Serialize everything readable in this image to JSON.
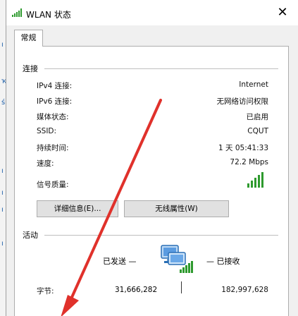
{
  "window": {
    "title": "WLAN 状态",
    "close_glyph": "✕"
  },
  "tabs": [
    {
      "label": "常规"
    }
  ],
  "connection": {
    "group_title": "连接",
    "rows": [
      {
        "label": "IPv4 连接:",
        "value": "Internet"
      },
      {
        "label": "IPv6 连接:",
        "value": "无网络访问权限"
      },
      {
        "label": "媒体状态:",
        "value": "已启用"
      },
      {
        "label": "SSID:",
        "value": "CQUT"
      },
      {
        "label": "持续时间:",
        "value": "1 天 05:41:33"
      },
      {
        "label": "速度:",
        "value": "72.2 Mbps"
      },
      {
        "label": "信号质量:",
        "value": ""
      }
    ],
    "signal_color": "#2e9a2e"
  },
  "buttons": {
    "details_label": "详细信息(E)...",
    "wireless_props_label": "无线属性(W)"
  },
  "activity": {
    "group_title": "活动",
    "sent_label": "已发送 —",
    "received_label": "— 已接收",
    "bytes_label": "字节:",
    "bytes_sent": "31,666,282",
    "bytes_received": "182,997,628"
  },
  "annotation": {
    "arrow_color": "#e0312b"
  }
}
